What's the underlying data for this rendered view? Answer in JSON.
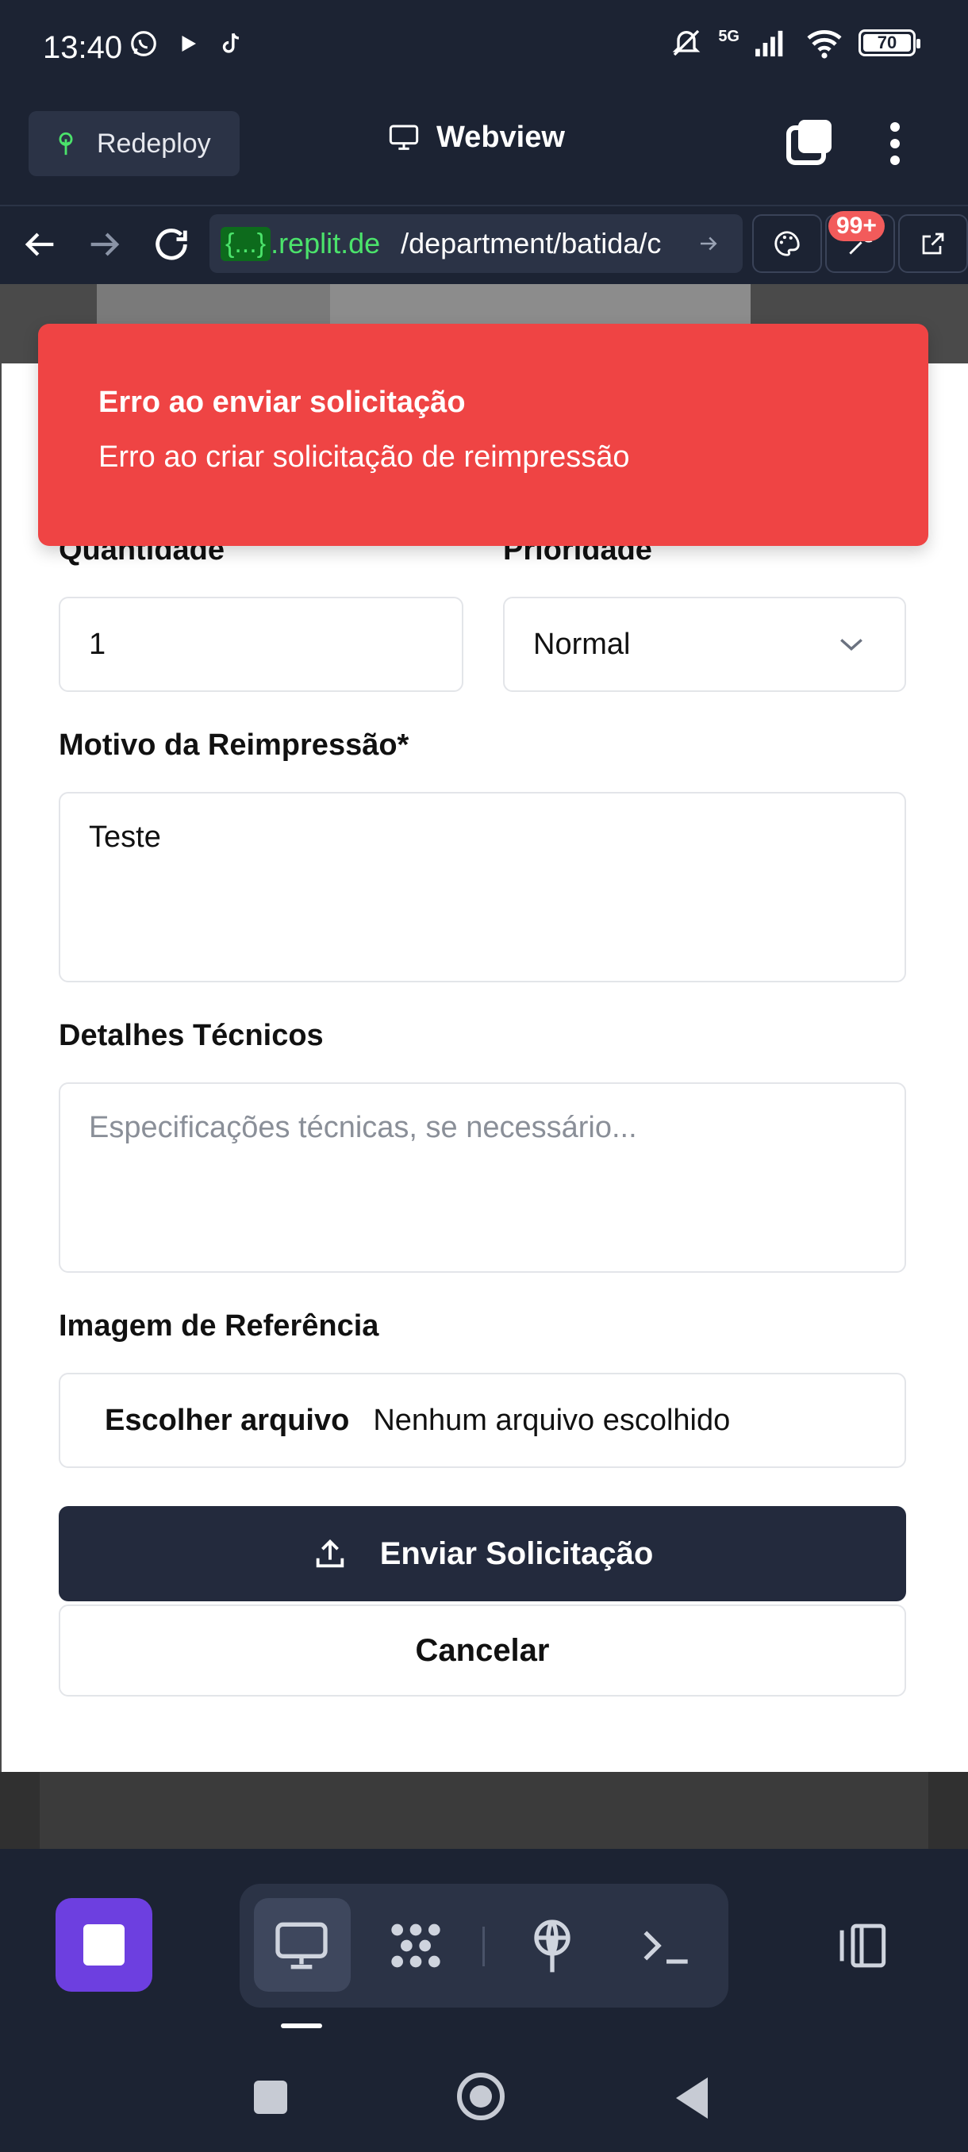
{
  "status_bar": {
    "time": "13:40",
    "network": "5G",
    "battery": "70"
  },
  "header": {
    "redeploy_label": "Redeploy",
    "title": "Webview"
  },
  "url_bar": {
    "badge": "{...}",
    "domain": ".replit.de",
    "path": "/department/batida/c",
    "notifications": "99+"
  },
  "toast": {
    "title": "Erro ao enviar solicitação",
    "message": "Erro ao criar solicitação de reimpressão",
    "color": "#ef4444"
  },
  "form": {
    "quantity_label": "Quantidade",
    "quantity_value": "1",
    "priority_label": "Prioridade",
    "priority_value": "Normal",
    "reason_label": "Motivo da Reimpressão*",
    "reason_value": "Teste",
    "technical_label": "Detalhes Técnicos",
    "technical_placeholder": "Especificações técnicas, se necessário...",
    "image_label": "Imagem de Referência",
    "file_button": "Escolher arquivo",
    "file_status": "Nenhum arquivo escolhido",
    "submit_label": "Enviar Solicitação",
    "cancel_label": "Cancelar"
  },
  "toolbar": {
    "accent": "#6d3fe0"
  }
}
